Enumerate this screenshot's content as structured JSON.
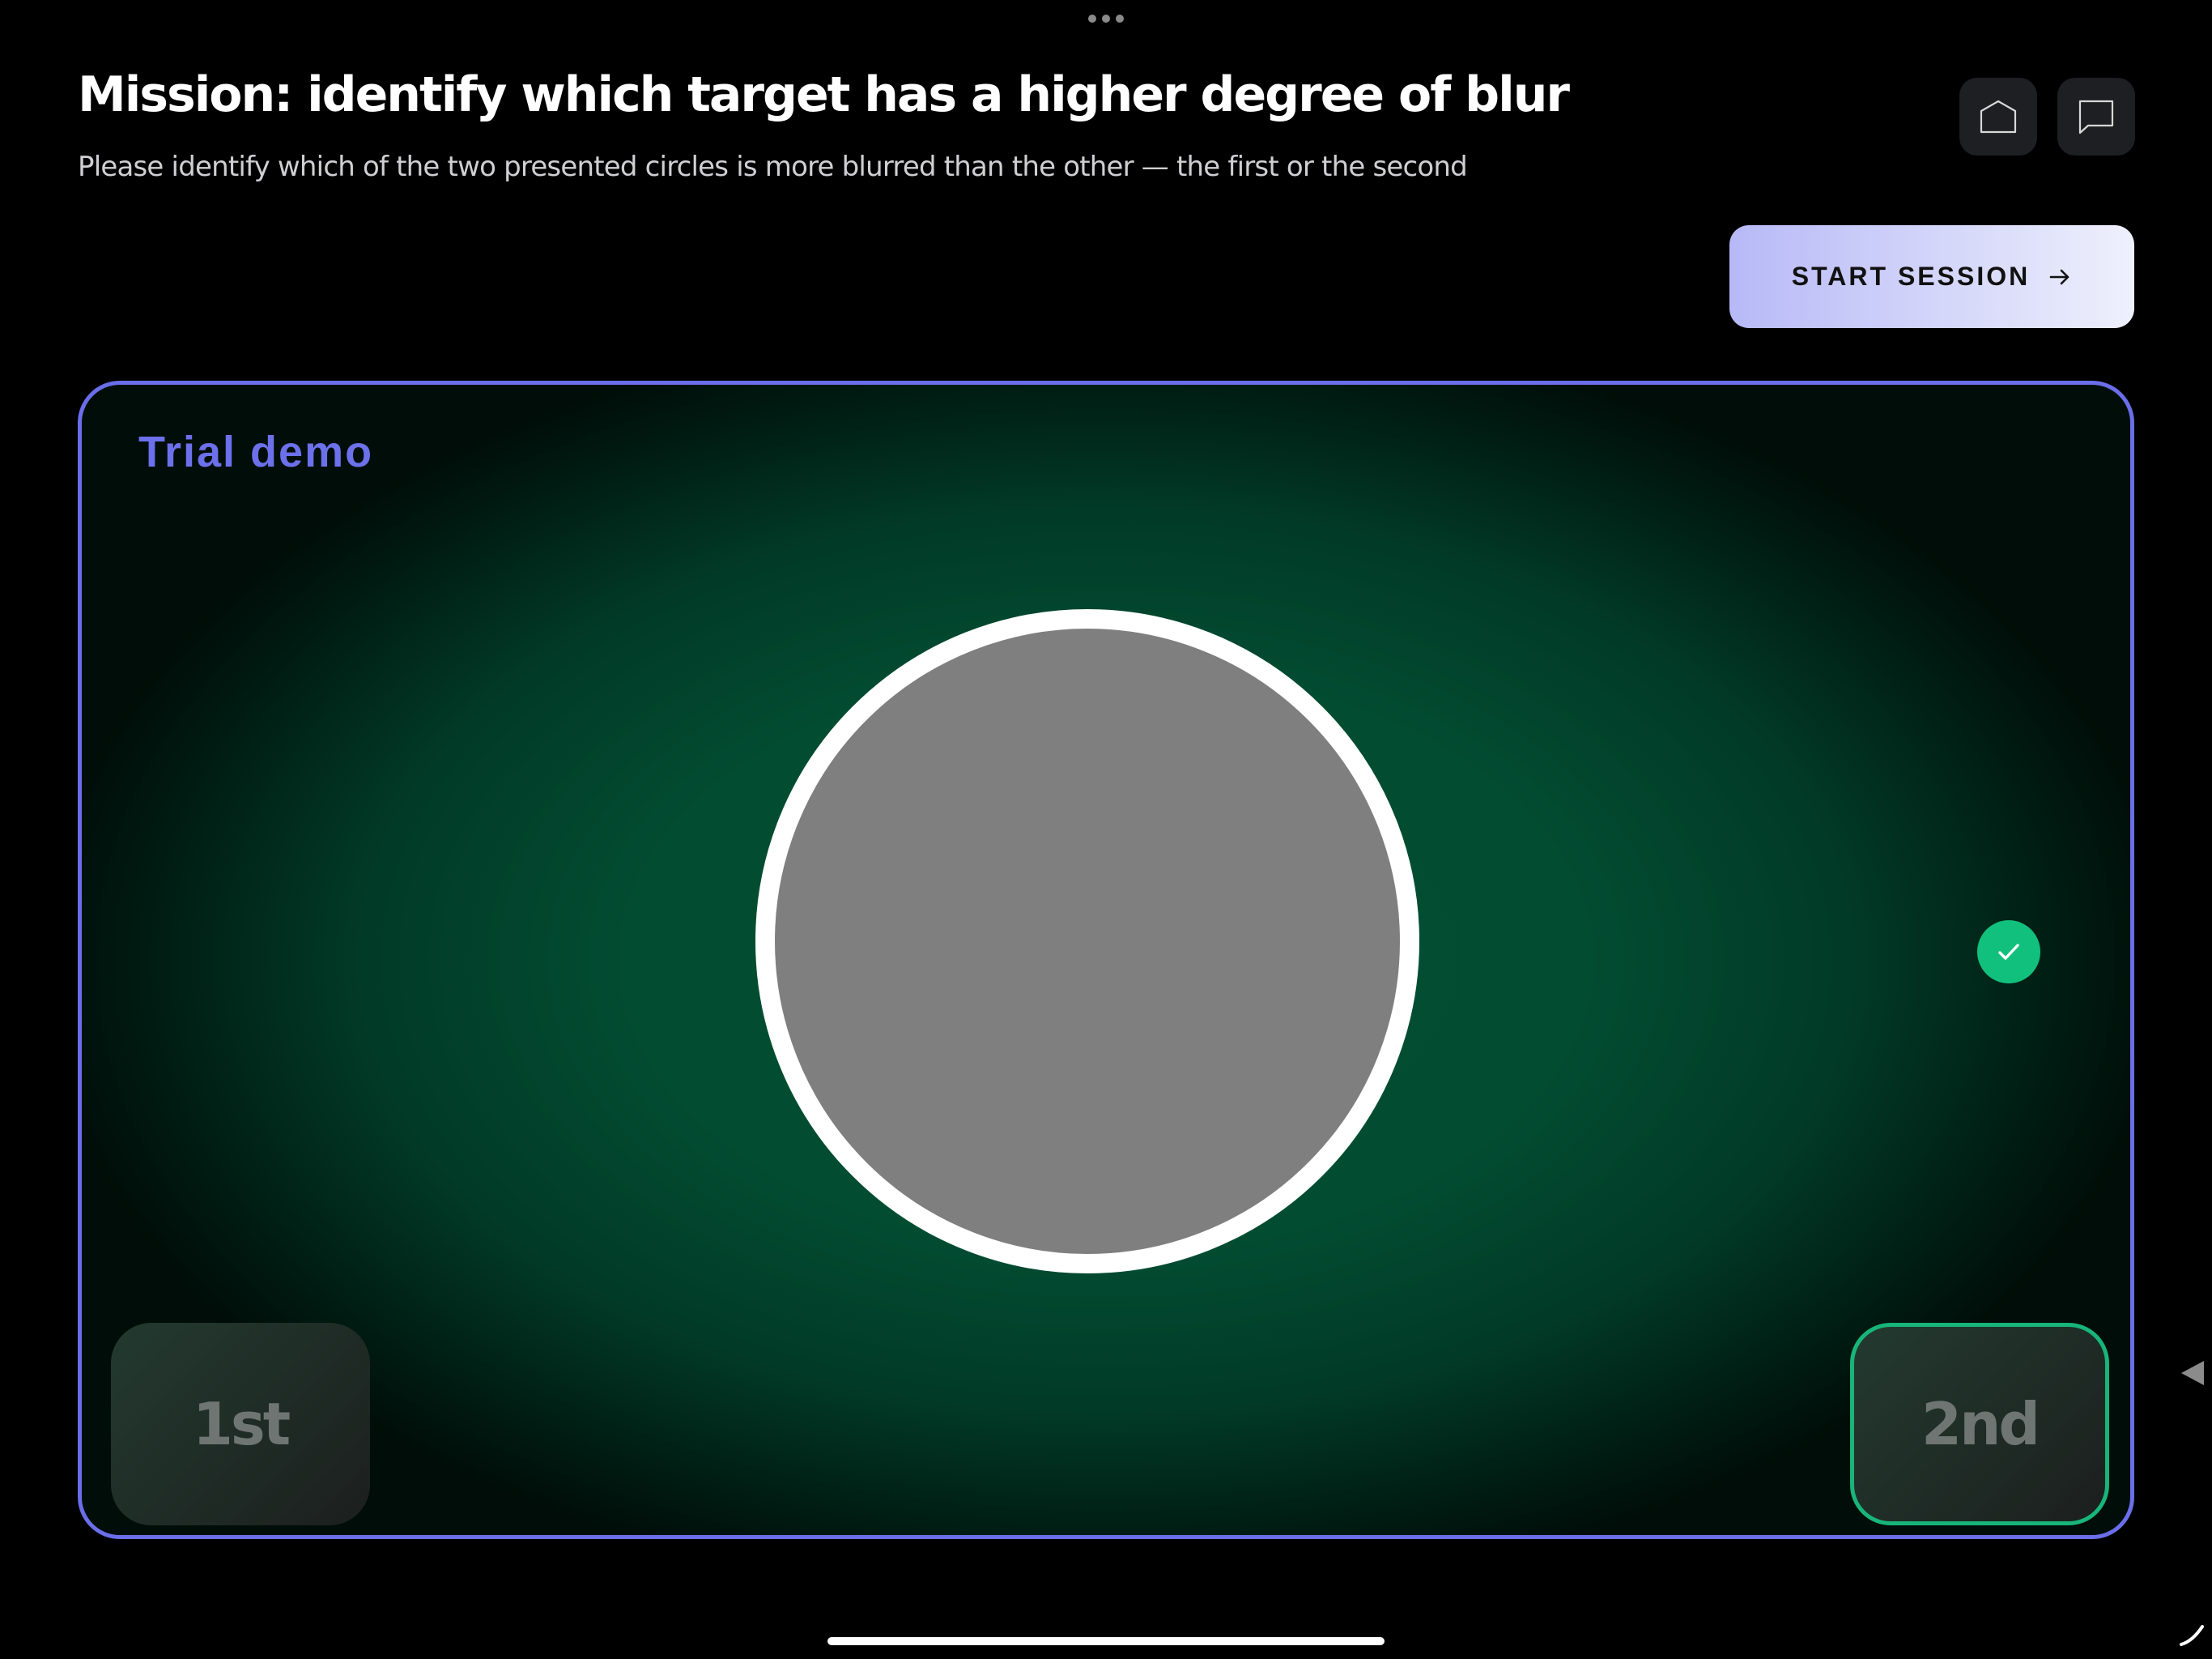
{
  "header": {
    "title": "Mission: identify which target has a higher degree of blur",
    "subtitle": "Please identify which of the two presented circles is more blurred than the other — the first or the second"
  },
  "toolbar": {
    "home_icon": "home-icon",
    "chat_icon": "chat-bubble-icon"
  },
  "start_button": {
    "label": "START SESSION",
    "icon": "arrow-right-icon"
  },
  "trial": {
    "label": "Trial demo",
    "target": {
      "fill_color": "#7f7f7f",
      "ring_color": "#ffffff"
    },
    "choices": [
      {
        "label": "1st",
        "selected": false
      },
      {
        "label": "2nd",
        "selected": true
      }
    ],
    "selected_icon": "checkmark-icon"
  },
  "colors": {
    "accent": "#6a6ee8",
    "success": "#12c07d",
    "panel_green": "#024f34",
    "background": "#000000"
  }
}
